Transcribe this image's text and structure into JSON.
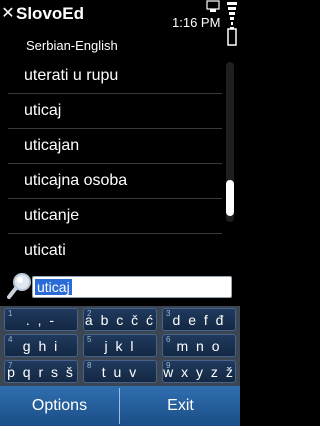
{
  "status_bar": {
    "app_title": "SlovoEd",
    "time": "1:16 PM"
  },
  "subtitle": "Serbian-English",
  "list": {
    "items": [
      "uterati u rupu",
      "uticaj",
      "uticajan",
      "uticajna osoba",
      "uticanje",
      "uticati"
    ]
  },
  "search": {
    "value": "uticaj"
  },
  "keypad": {
    "keys": [
      {
        "num": "1",
        "letters": ". , -"
      },
      {
        "num": "2",
        "letters": "a b c č ć"
      },
      {
        "num": "3",
        "letters": "d e f đ"
      },
      {
        "num": "4",
        "letters": "g h i"
      },
      {
        "num": "5",
        "letters": "j k l"
      },
      {
        "num": "6",
        "letters": "m n o"
      },
      {
        "num": "7",
        "letters": "p q r s š"
      },
      {
        "num": "8",
        "letters": "t u v"
      },
      {
        "num": "9",
        "letters": "w x y z ž"
      }
    ]
  },
  "softkeys": {
    "left": "Options",
    "right": "Exit"
  },
  "colors": {
    "softkey_bar": "#2f6fb0",
    "key_bg": "#1a3150",
    "selection": "#2a6bd6"
  }
}
